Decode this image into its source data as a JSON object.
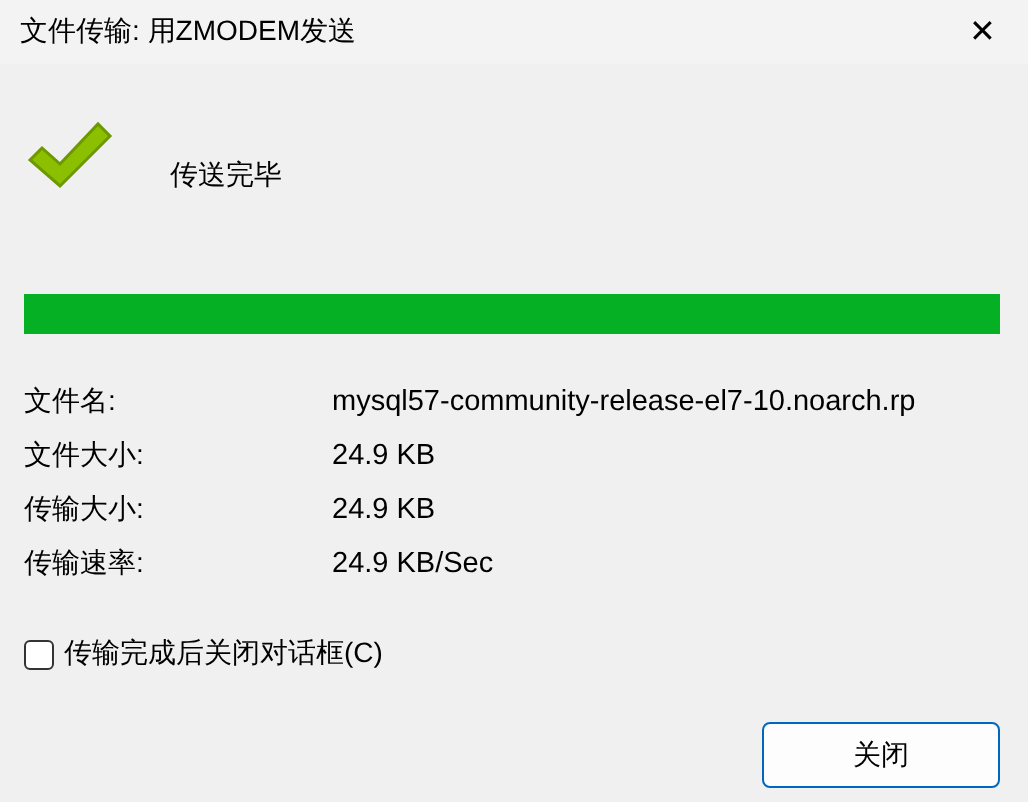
{
  "window": {
    "title": "文件传输: 用ZMODEM发送",
    "close": "✕"
  },
  "status": {
    "kind": "success",
    "message": "传送完毕"
  },
  "progress": {
    "level": 1
  },
  "details": [
    {
      "label": "文件名:",
      "value": "mysql57-community-release-el7-10.noarch.rp"
    },
    {
      "label": "文件大小:",
      "value": "24.9 KB"
    },
    {
      "label": "传输大小:",
      "value": "24.9 KB"
    },
    {
      "label": "传输速率:",
      "value": "24.9 KB/Sec"
    }
  ],
  "close_when_done": {
    "label": "传输完成后关闭对话框(C)",
    "checked": false
  },
  "buttons": [
    "关闭"
  ]
}
